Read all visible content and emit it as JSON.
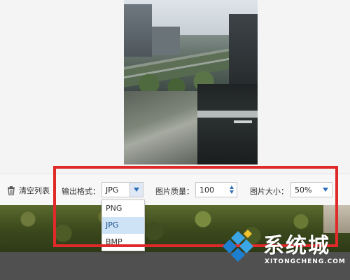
{
  "toolbar": {
    "clear_list_label": "清空列表",
    "output_format_label": "输出格式：",
    "output_format_value": "JPG",
    "image_quality_label": "图片质量：",
    "image_quality_value": "100",
    "image_size_label": "图片大小：",
    "image_size_value": "50%"
  },
  "format_dropdown": {
    "options": [
      "PNG",
      "JPG",
      "BMP"
    ],
    "selected": "JPG"
  },
  "watermark": {
    "brand": "系统城",
    "url": "XITONGCHENG.COM"
  },
  "colors": {
    "highlight": "#e02a2a",
    "accent": "#2e6fb7",
    "dropdown_selected_bg": "#cfe3f7"
  },
  "icons": {
    "clear": "trash-icon",
    "dropdown": "chevron-down-icon",
    "stepper_up": "caret-up-icon",
    "stepper_down": "caret-down-icon"
  }
}
